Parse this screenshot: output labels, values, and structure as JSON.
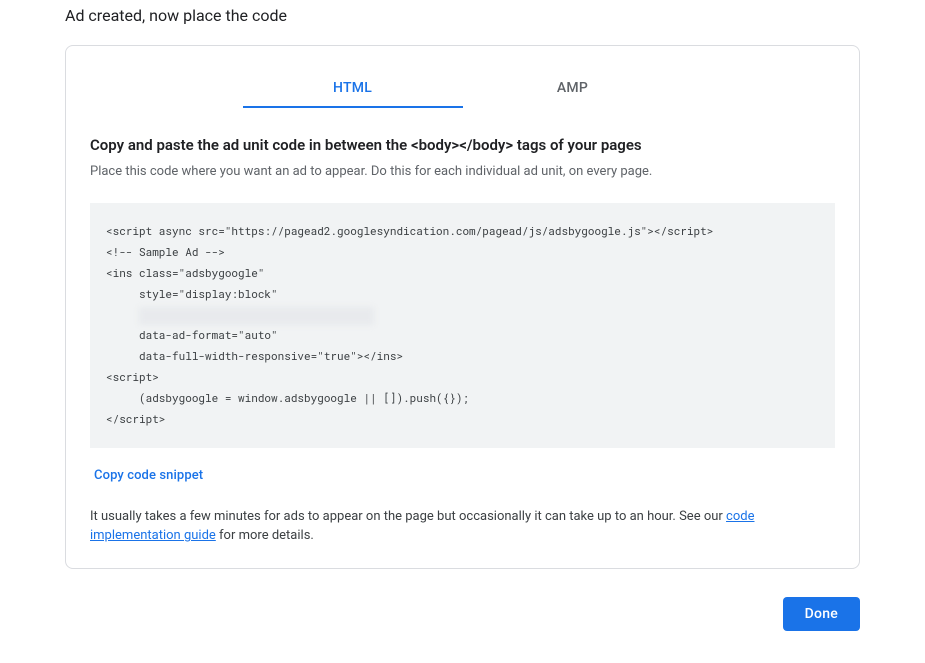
{
  "page_title": "Ad created, now place the code",
  "tabs": {
    "html": "HTML",
    "amp": "AMP",
    "active": "html"
  },
  "content": {
    "heading": "Copy and paste the ad unit code in between the <body></body> tags of your pages",
    "subheading": "Place this code where you want an ad to appear. Do this for each individual ad unit, on every page."
  },
  "code": {
    "line1": "<script async src=\"https://pagead2.googlesyndication.com/pagead/js/adsbygoogle.js\"></script>",
    "line2": "<!-- Sample Ad -->",
    "line3": "<ins class=\"adsbygoogle\"",
    "line4": "     style=\"display:block\"",
    "line5_redacted": true,
    "line6": "     data-ad-format=\"auto\"",
    "line7": "     data-full-width-responsive=\"true\"></ins>",
    "line8": "<script>",
    "line9": "     (adsbygoogle = window.adsbygoogle || []).push({});",
    "line10": "</script>"
  },
  "copy_link": "Copy code snippet",
  "note": {
    "prefix": "It usually takes a few minutes for ads to appear on the page but occasionally it can take up to an hour. See our ",
    "link": "code implementation guide",
    "suffix": " for more details."
  },
  "done_button": "Done"
}
